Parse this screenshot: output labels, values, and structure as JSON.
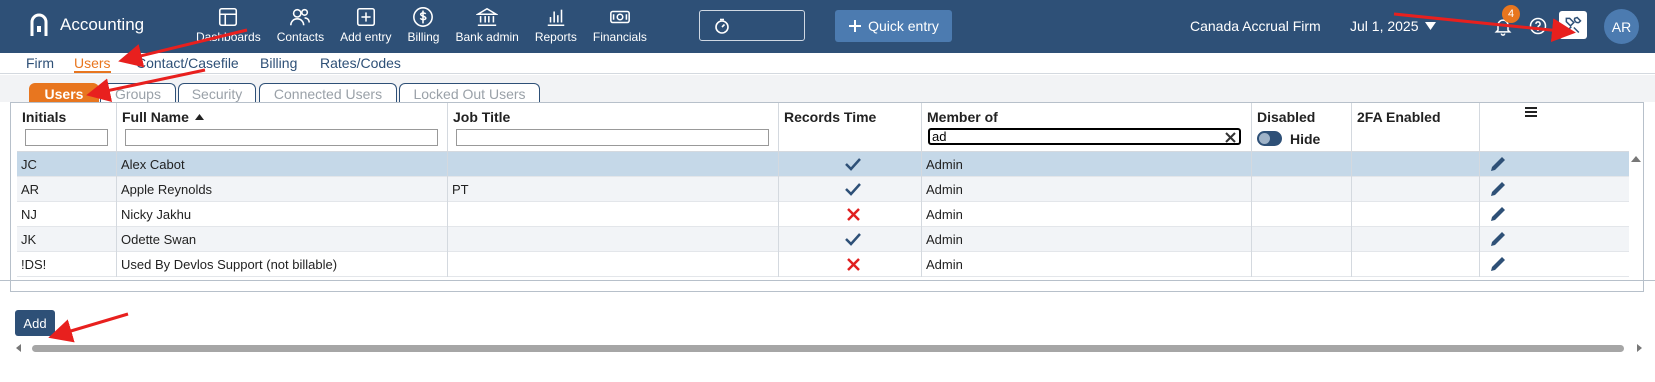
{
  "app": {
    "title": "Accounting"
  },
  "nav": [
    {
      "label": "Dashboards",
      "icon": "dashboard-icon"
    },
    {
      "label": "Contacts",
      "icon": "contacts-icon"
    },
    {
      "label": "Add entry",
      "icon": "add-entry-icon"
    },
    {
      "label": "Billing",
      "icon": "dollar-icon"
    },
    {
      "label": "Bank admin",
      "icon": "bank-icon"
    },
    {
      "label": "Reports",
      "icon": "bar-chart-icon"
    },
    {
      "label": "Financials",
      "icon": "cash-icon"
    }
  ],
  "header": {
    "quick_entry": "Quick entry",
    "firm": "Canada Accrual Firm",
    "date": "Jul 1, 2025",
    "notifications": "4",
    "avatar": "AR"
  },
  "subnav": [
    "Firm",
    "Users",
    "Contact/Casefile",
    "Billing",
    "Rates/Codes"
  ],
  "subnav_active": "Users",
  "tabs": [
    "Users",
    "Groups",
    "Security",
    "Connected Users",
    "Locked Out Users"
  ],
  "tabs_active": "Users",
  "grid": {
    "columns": [
      "Initials",
      "Full Name",
      "Job Title",
      "Records Time",
      "Member of",
      "Disabled",
      "2FA Enabled"
    ],
    "filters": {
      "member_of": "ad",
      "disabled_toggle_label": "Hide"
    },
    "rows": [
      {
        "initials": "JC",
        "full_name": "Alex Cabot",
        "job_title": "",
        "records_time": true,
        "member_of": "Admin"
      },
      {
        "initials": "AR",
        "full_name": "Apple Reynolds",
        "job_title": "PT",
        "records_time": true,
        "member_of": "Admin"
      },
      {
        "initials": "NJ",
        "full_name": "Nicky Jakhu",
        "job_title": "",
        "records_time": false,
        "member_of": "Admin"
      },
      {
        "initials": "JK",
        "full_name": "Odette Swan",
        "job_title": "",
        "records_time": true,
        "member_of": "Admin"
      },
      {
        "initials": "!DS!",
        "full_name": "Used By Devlos Support (not billable)",
        "job_title": "",
        "records_time": false,
        "member_of": "Admin"
      }
    ]
  },
  "add_label": "Add",
  "colors": {
    "header": "#2e5077",
    "accent": "#e8761f",
    "selected_row": "#c5d8e8",
    "check": "#2e5077",
    "cross": "#e02020",
    "annotation": "#e8201e"
  }
}
